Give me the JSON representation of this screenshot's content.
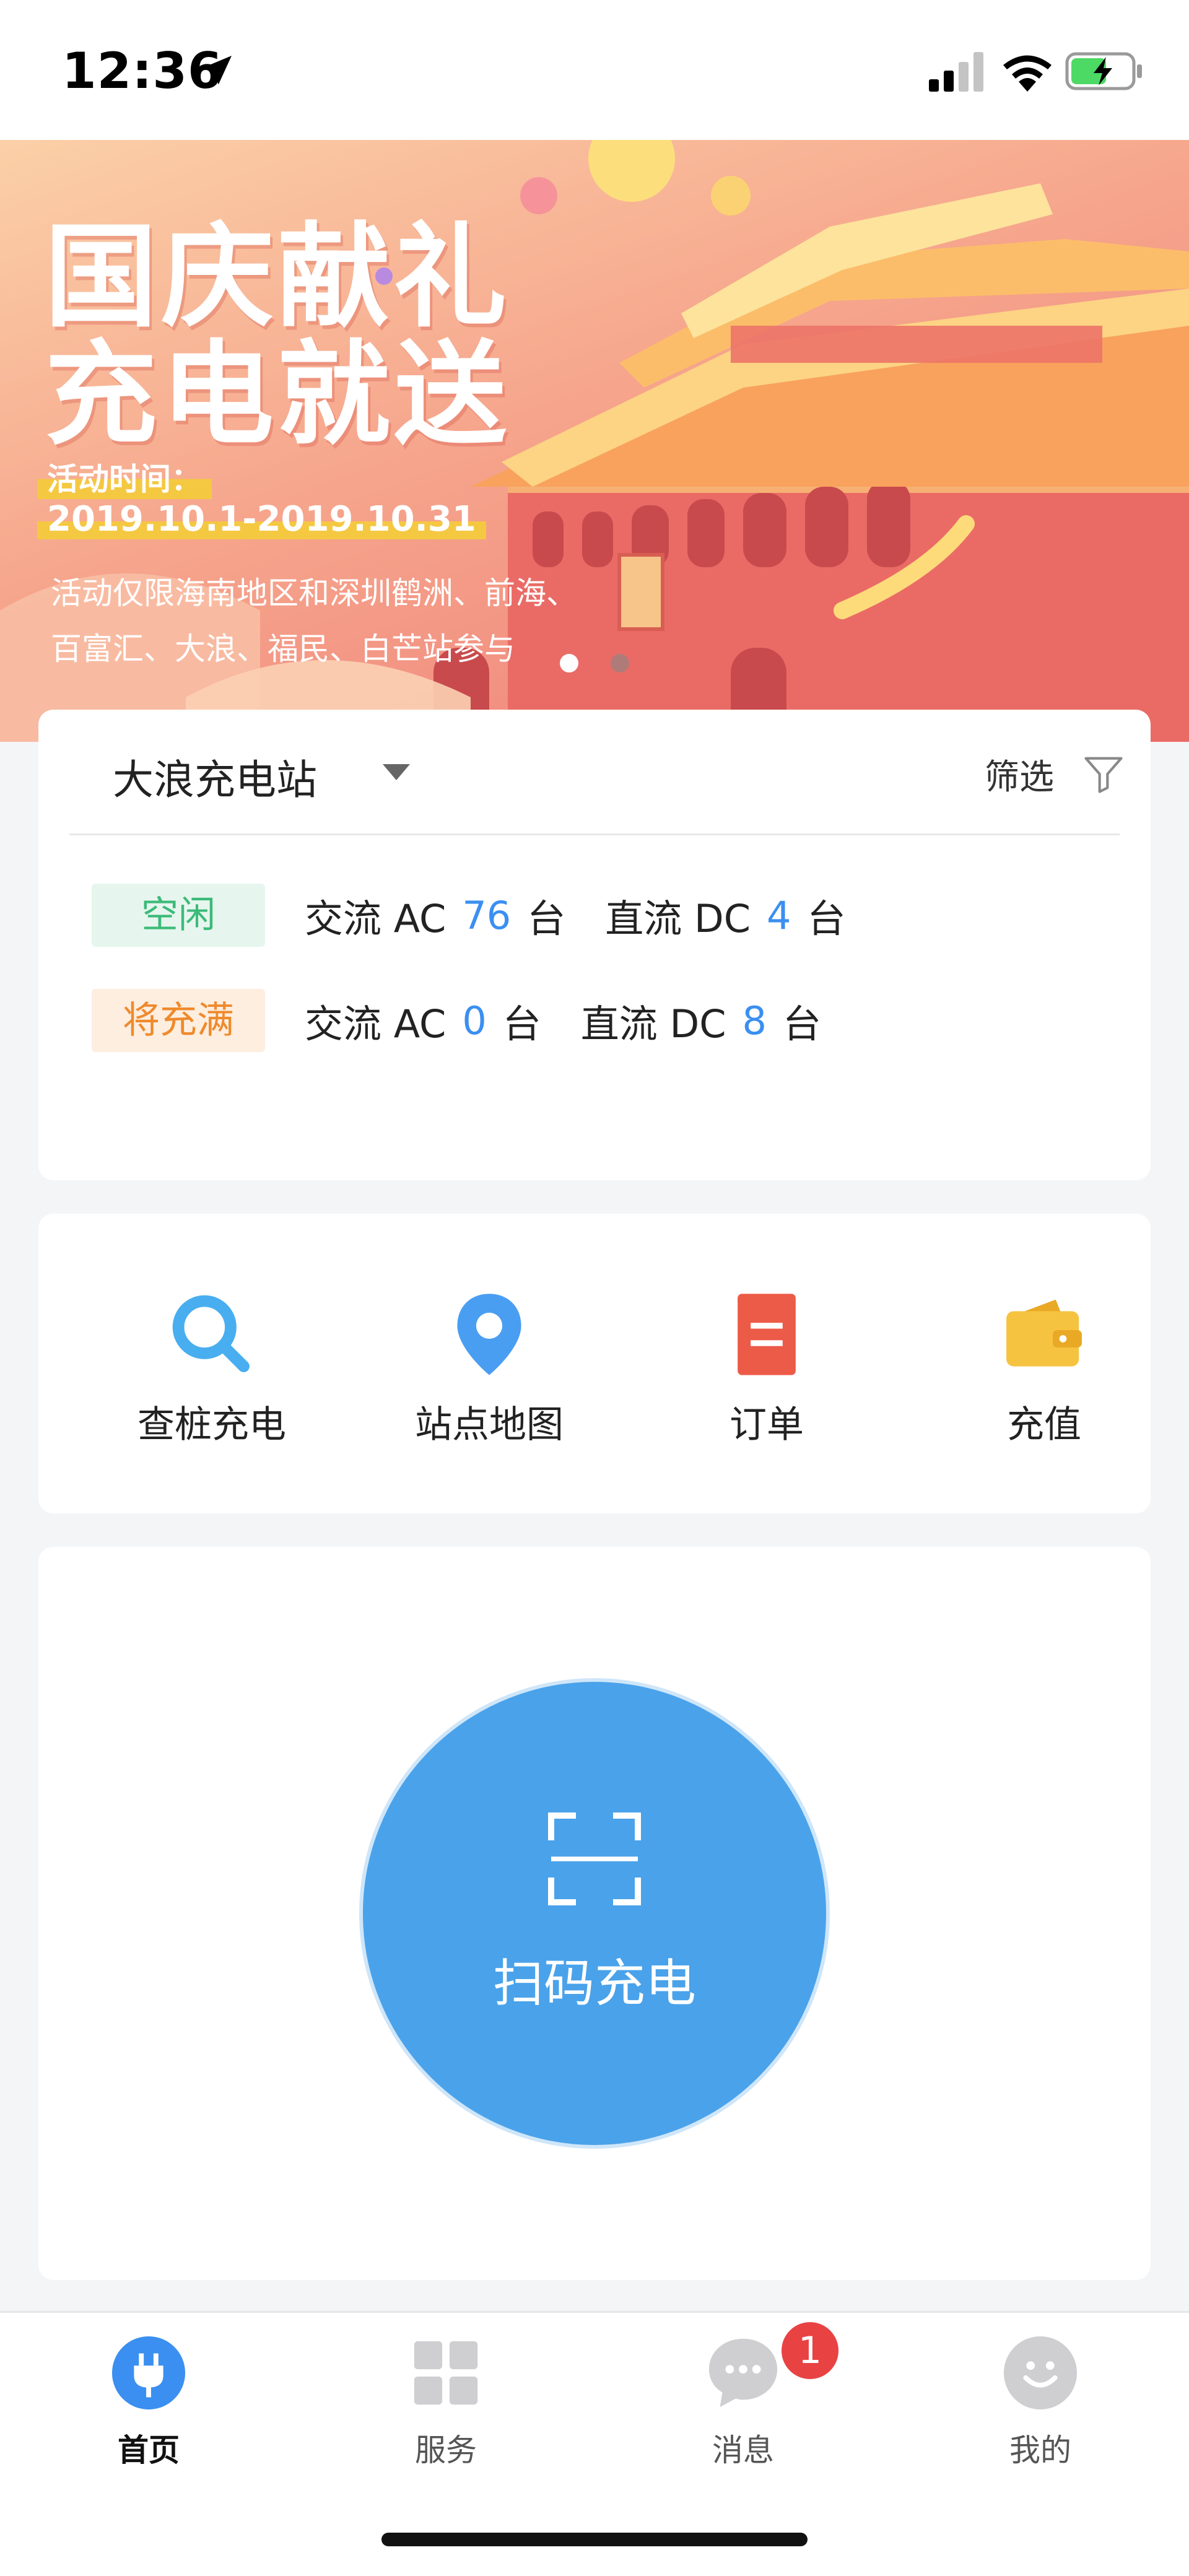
{
  "status_bar": {
    "time": "12:36"
  },
  "banner": {
    "title_line1": "国庆献礼",
    "title_line2": "充电就送",
    "date_label": "活动时间：",
    "date_range": "2019.10.1-2019.10.31",
    "note_line1": "活动仅限海南地区和深圳鹤洲、前海、",
    "note_line2": "百富汇、大浪、福民、白芒站参与",
    "pagination": {
      "total": 2,
      "active": 1
    }
  },
  "station": {
    "name": "大浪充电站",
    "filter_label": "筛选",
    "rows": [
      {
        "status": "空闲",
        "ac_label": "交流 AC",
        "ac_count": "76",
        "ac_unit": "台",
        "dc_label": "直流 DC",
        "dc_count": "4",
        "dc_unit": "台"
      },
      {
        "status": "将充满",
        "ac_label": "交流 AC",
        "ac_count": "0",
        "ac_unit": "台",
        "dc_label": "直流 DC",
        "dc_count": "8",
        "dc_unit": "台"
      }
    ]
  },
  "menu": [
    {
      "label": "查桩充电",
      "icon": "search-icon"
    },
    {
      "label": "站点地图",
      "icon": "map-pin-icon"
    },
    {
      "label": "订单",
      "icon": "order-icon"
    },
    {
      "label": "充值",
      "icon": "wallet-icon"
    }
  ],
  "scan": {
    "label": "扫码充电",
    "icon": "scan-icon"
  },
  "tabbar": {
    "tabs": [
      {
        "label": "首页",
        "icon": "plug-icon",
        "active": true
      },
      {
        "label": "服务",
        "icon": "grid-icon",
        "active": false
      },
      {
        "label": "消息",
        "icon": "chat-icon",
        "active": false,
        "badge": "1"
      },
      {
        "label": "我的",
        "icon": "smile-icon",
        "active": false
      }
    ]
  },
  "colors": {
    "accent": "#3b8ff0",
    "scan_button": "#4aa2ea",
    "idle_tag": "#3cba7a",
    "full_tag": "#ef8a2c",
    "badge": "#e94243"
  }
}
